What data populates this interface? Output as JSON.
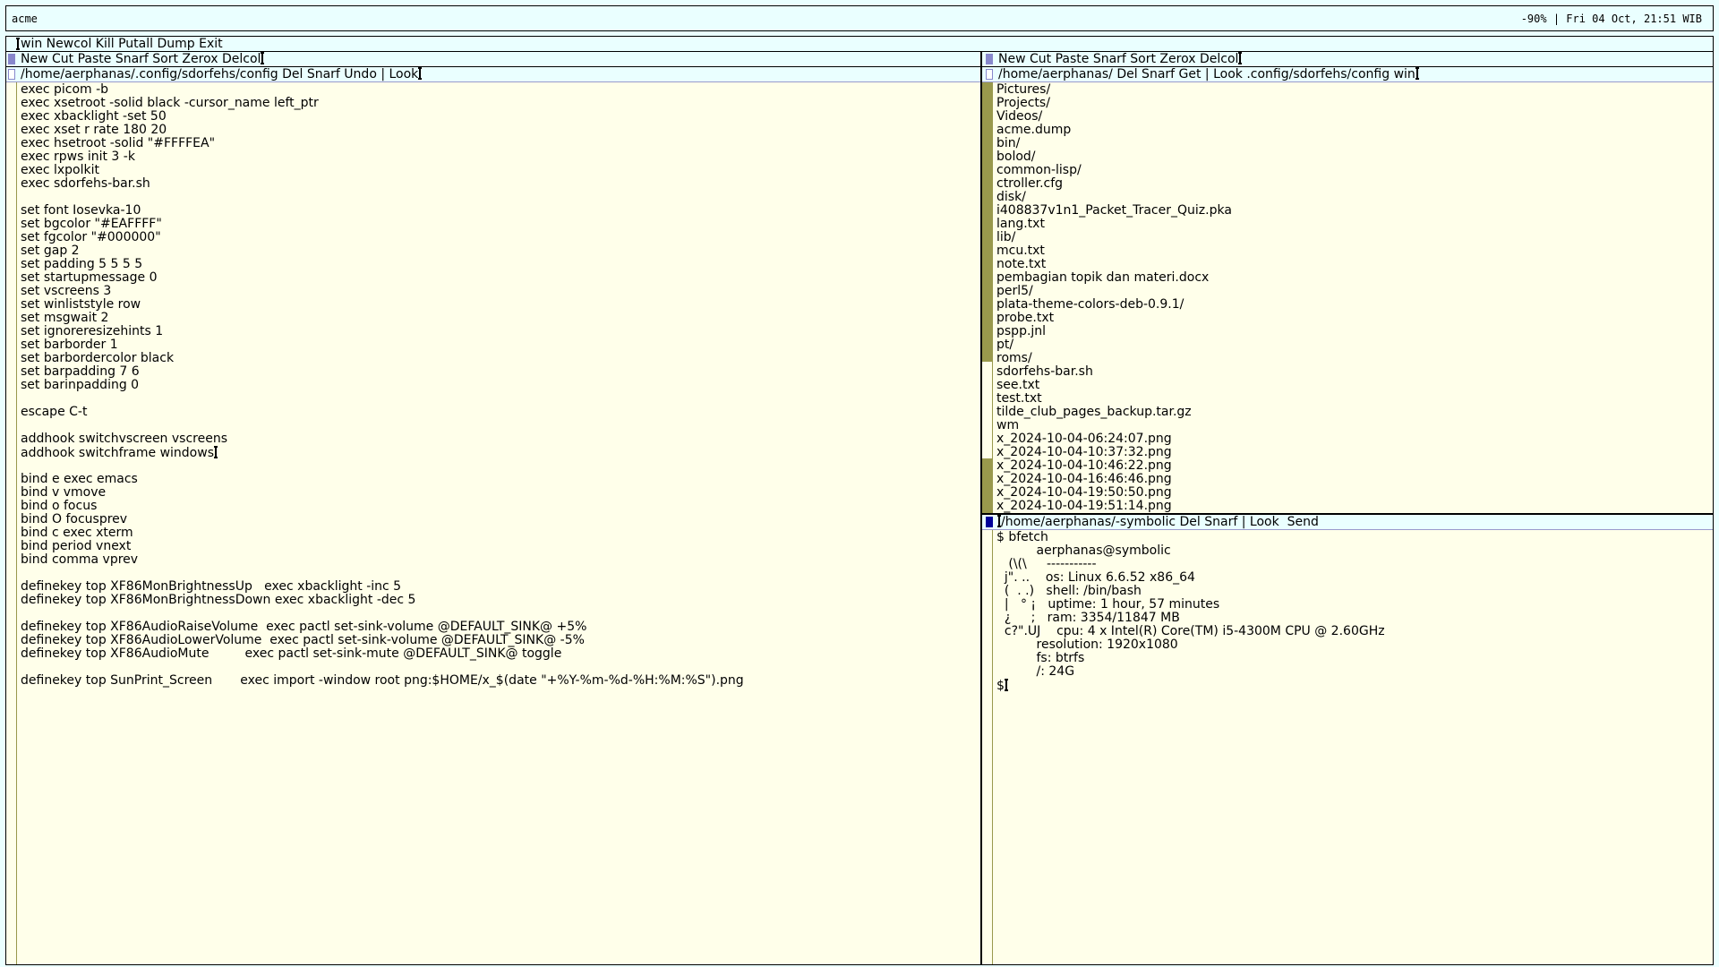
{
  "bar": {
    "left": "acme",
    "right": "-90% | Fri 04 Oct, 21:51 WIB"
  },
  "acme": {
    "main_tag": "win Newcol Kill Putall Dump Exit",
    "left_column": {
      "tag": "New Cut Paste Snarf Sort Zerox Delcol",
      "window": {
        "tag": "/home/aerphanas/.config/sdorfehs/config Del Snarf Undo | Look",
        "lines": [
          "exec picom -b",
          "exec xsetroot -solid black -cursor_name left_ptr",
          "exec xbacklight -set 50",
          "exec xset r rate 180 20",
          "exec hsetroot -solid \"#FFFFEA\"",
          "exec rpws init 3 -k",
          "exec lxpolkit",
          "exec sdorfehs-bar.sh",
          "",
          "set font Iosevka-10",
          "set bgcolor \"#EAFFFF\"",
          "set fgcolor \"#000000\"",
          "set gap 2",
          "set padding 5 5 5 5",
          "set startupmessage 0",
          "set vscreens 3",
          "set winliststyle row",
          "set msgwait 2",
          "set ignoreresizehints 1",
          "set barborder 1",
          "set barbordercolor black",
          "set barpadding 7 6",
          "set barinpadding 0",
          "",
          "escape C-t",
          "",
          "addhook switchvscreen vscreens",
          "addhook switchframe windows",
          "",
          "bind e exec emacs",
          "bind v vmove",
          "bind o focus",
          "bind O focusprev",
          "bind c exec xterm",
          "bind period vnext",
          "bind comma vprev",
          "",
          "definekey top XF86MonBrightnessUp   exec xbacklight -inc 5",
          "definekey top XF86MonBrightnessDown exec xbacklight -dec 5",
          "",
          "definekey top XF86AudioRaiseVolume  exec pactl set-sink-volume @DEFAULT_SINK@ +5%",
          "definekey top XF86AudioLowerVolume  exec pactl set-sink-volume @DEFAULT_SINK@ -5%",
          "definekey top XF86AudioMute         exec pactl set-sink-mute @DEFAULT_SINK@ toggle",
          "",
          "definekey top SunPrint_Screen       exec import -window root png:$HOME/x_$(date \"+%Y-%m-%d-%H:%M:%S\").png"
        ]
      }
    },
    "right_column": {
      "tag": "New Cut Paste Snarf Sort Zerox Delcol",
      "dir_window": {
        "tag": "/home/aerphanas/ Del Snarf Get | Look .config/sdorfehs/config win",
        "lines": [
          "Pictures/",
          "Projects/",
          "Videos/",
          "acme.dump",
          "bin/",
          "bolod/",
          "common-lisp/",
          "ctroller.cfg",
          "disk/",
          "i408837v1n1_Packet_Tracer_Quiz.pka",
          "lang.txt",
          "lib/",
          "mcu.txt",
          "note.txt",
          "pembagian topik dan materi.docx",
          "perl5/",
          "plata-theme-colors-deb-0.9.1/",
          "probe.txt",
          "pspp.jnl",
          "pt/",
          "roms/",
          "sdorfehs-bar.sh",
          "see.txt",
          "test.txt",
          "tilde_club_pages_backup.tar.gz",
          "wm",
          "x_2024-10-04-06:24:07.png",
          "x_2024-10-04-10:37:32.png",
          "x_2024-10-04-10:46:22.png",
          "x_2024-10-04-16:46:46.png",
          "x_2024-10-04-19:50:50.png",
          "x_2024-10-04-19:51:14.png"
        ]
      },
      "shell_window": {
        "tag": "/home/aerphanas/-symbolic Del Snarf | Look  Send",
        "lines": [
          "$ bfetch",
          "          aerphanas@symbolic",
          "   (\\(\\     -----------",
          "  j\". ..    os: Linux 6.6.52 x86_64",
          "  (  . .)   shell: /bin/bash",
          "  |   ° ¡   uptime: 1 hour, 57 minutes",
          "  ¿     ;   ram: 3354/11847 MB",
          "  c?\".UJ    cpu: 4 x Intel(R) Core(TM) i5-4300M CPU @ 2.60GHz",
          "          resolution: 1920x1080",
          "          fs: btrfs",
          "          /: 24G",
          "$"
        ]
      }
    }
  }
}
